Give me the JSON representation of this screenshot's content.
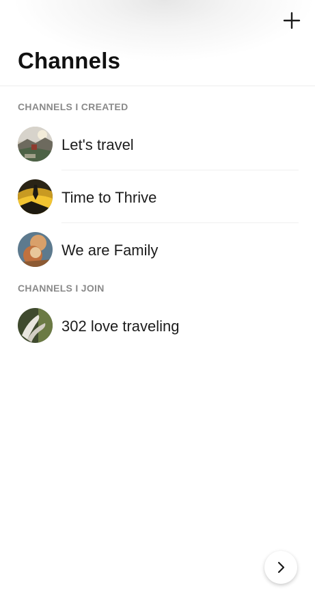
{
  "header": {
    "title": "Channels",
    "add_icon": "plus-icon"
  },
  "sections": {
    "created": {
      "label": "CHANNELS I CREATED",
      "items": [
        {
          "name": "Let's travel",
          "avatar": "landscape-photo"
        },
        {
          "name": "Time to Thrive",
          "avatar": "sunset-climber-photo"
        },
        {
          "name": "We are Family",
          "avatar": "toy-figure-photo"
        }
      ]
    },
    "joined": {
      "label": "CHANNELS I JOIN",
      "items": [
        {
          "name": "302 love traveling",
          "avatar": "hands-photo"
        }
      ]
    }
  },
  "fab": {
    "icon": "chevron-right-icon"
  },
  "colors": {
    "title": "#111111",
    "section_label": "#8a8a8a",
    "divider": "#efefef"
  }
}
